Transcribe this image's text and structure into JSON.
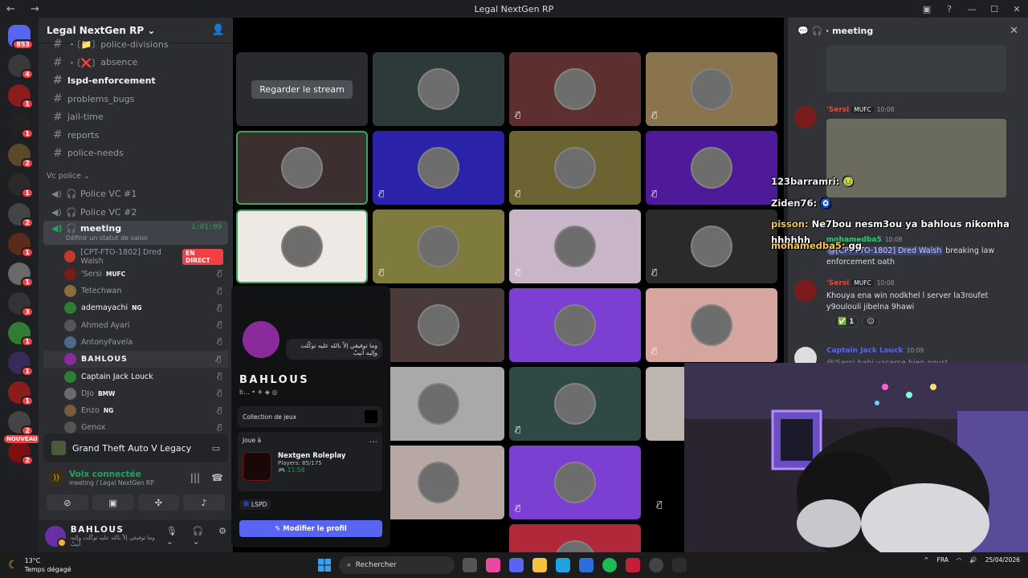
{
  "window": {
    "title": "Legal NextGen RP"
  },
  "servers": {
    "home_badge": "853",
    "badges": [
      "4",
      "1",
      "1",
      "2",
      "1",
      "2",
      "1",
      "1",
      "3",
      "1",
      "1",
      "1",
      "2",
      "2",
      "1"
    ],
    "new_label": "NOUVEAU"
  },
  "guild": {
    "name": "Legal NextGen RP",
    "channels": [
      {
        "label": "police-divisions",
        "prefix": "・〔📁〕",
        "bold": false
      },
      {
        "label": "absence",
        "prefix": "・〔❌〕",
        "bold": false
      },
      {
        "label": "lspd-enforcement",
        "prefix": "",
        "bold": true
      },
      {
        "label": "problems_bugs",
        "prefix": "",
        "bold": false
      },
      {
        "label": "jail-time",
        "prefix": "",
        "bold": false
      },
      {
        "label": "reports",
        "prefix": "",
        "bold": false
      },
      {
        "label": "police-needs",
        "prefix": "",
        "bold": false
      }
    ],
    "voice_category": "Vc police",
    "voice_channels": [
      {
        "label": "Police VC #1"
      },
      {
        "label": "Police VC #2"
      }
    ],
    "active_voice": {
      "label": "meeting",
      "time": "1:01:09",
      "status": "Définir un statut de salon"
    },
    "members": [
      {
        "name": "[CPT-FTO-1802] Dred Walsh",
        "tag": "",
        "live": "EN DIRECT",
        "color": "#c0392b"
      },
      {
        "name": "'Sersi",
        "tag": "MUFC",
        "live": "",
        "color": "#7a1c1c"
      },
      {
        "name": "Tetechwan",
        "tag": "",
        "live": "",
        "color": "#8a6d3b"
      },
      {
        "name": "ademayachi",
        "tag": "NG",
        "live": "",
        "color": "#2e7d32"
      },
      {
        "name": "Ahmed Ayari",
        "tag": "",
        "live": "",
        "color": "#555"
      },
      {
        "name": "AntonyFavela",
        "tag": "",
        "live": "",
        "color": "#4a6a8a"
      },
      {
        "name": "BAHLOUS",
        "tag": "",
        "live": "",
        "color": "#8a2a9b"
      },
      {
        "name": "Captain Jack Louck",
        "tag": "",
        "live": "",
        "color": "#2e7d32"
      },
      {
        "name": "DJo",
        "tag": "BMW",
        "live": "",
        "color": "#6a6a6a"
      },
      {
        "name": "Enzo",
        "tag": "NG",
        "live": "",
        "color": "#7a5a3a"
      },
      {
        "name": "Genox",
        "tag": "",
        "live": "",
        "color": "#555"
      }
    ]
  },
  "activity": {
    "game": "Grand Theft Auto V Legacy"
  },
  "voice": {
    "status": "Voix connectée",
    "location": "meeting / Legal NextGen RP"
  },
  "user": {
    "name": "BAHLOUS",
    "status": "وما توفيقي إلاّ بالله عليه توكّلت وإليه أنيبْ"
  },
  "grid": {
    "stream_label": "Regarder le stream"
  },
  "profile": {
    "name": "BAHLOUS",
    "sub": "b...",
    "bio": "وما توفيقي إلاّ بالله عليه توكّلت وإليه أنيبْ",
    "collection": "Collection de jeux",
    "playing_label": "Joue à",
    "game_name": "Nextgen Roleplay",
    "players": "Players: 85/175",
    "game_time": "11:58",
    "role": "LSPD",
    "edit": "Modifier le profil"
  },
  "chat": {
    "channel": "meeting",
    "m1": {
      "name": "'Sersi",
      "clan": "MUFC",
      "time": "10:08"
    },
    "m2": {
      "name": "mohamedba5",
      "time": "10:08",
      "mention": "@[CPT-FTO-1802] Dred Walsh",
      "text": "breaking law enforcement oath"
    },
    "m3": {
      "name": "'Sersi",
      "clan": "MUFC",
      "time": "10:08",
      "text": "Khouya ena win nodkhel l server la3roufet y9oulouli jibelna 9hawi",
      "react_count": "1"
    },
    "m4": {
      "name": "Captain Jack Louck",
      "time": "10:09",
      "text": "@'Sersi bahi yaserse bien pour!"
    }
  },
  "overlay_chat": [
    {
      "user": "123barramri:",
      "text": "🤢"
    },
    {
      "user": "Ziden76:",
      "text": "🧿"
    },
    {
      "user": "pisson:",
      "text": "Ne7bou nesm3ou ya bahlous nikomha hhhhhh"
    },
    {
      "user": "mohamedba5:",
      "text": "gg"
    }
  ],
  "taskbar": {
    "temp": "13°C",
    "weather": "Temps dégagé",
    "search": "Rechercher",
    "lang": "FRA",
    "date": "25/04/2026"
  },
  "colors": {
    "accent": "#5865f2",
    "online": "#23a55a",
    "live": "#f23f43"
  }
}
